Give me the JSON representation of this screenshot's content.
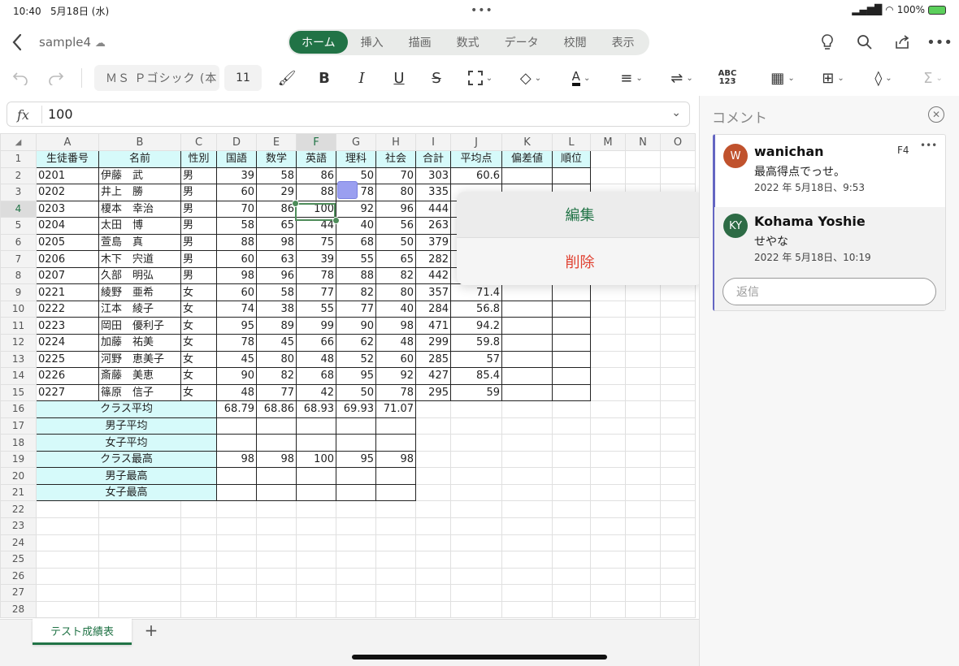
{
  "status": {
    "time": "10:40",
    "date": "5月18日 (水)",
    "battery": "100%"
  },
  "title": {
    "filename": "sample4"
  },
  "ribbon_tabs": [
    "ホーム",
    "挿入",
    "描画",
    "数式",
    "データ",
    "校閲",
    "表示"
  ],
  "toolbar": {
    "font": "ＭＳ Ｐゴシック (本",
    "size": "11"
  },
  "formula": {
    "fx": "fx",
    "value": "100"
  },
  "columns": [
    "A",
    "B",
    "C",
    "D",
    "E",
    "F",
    "G",
    "H",
    "I",
    "J",
    "K",
    "L",
    "M",
    "N",
    "O"
  ],
  "rows": [
    [
      "生徒番号",
      "名前",
      "性別",
      "国語",
      "数学",
      "英語",
      "理科",
      "社会",
      "合計",
      "平均点",
      "偏差値",
      "順位"
    ],
    [
      "0201",
      "伊藤　武",
      "男",
      "39",
      "58",
      "86",
      "50",
      "70",
      "303",
      "60.6",
      "",
      ""
    ],
    [
      "0202",
      "井上　勝",
      "男",
      "60",
      "29",
      "88",
      "78",
      "80",
      "335",
      "",
      "",
      ""
    ],
    [
      "0203",
      "榎本　幸治",
      "男",
      "70",
      "86",
      "100",
      "92",
      "96",
      "444",
      "",
      "",
      ""
    ],
    [
      "0204",
      "太田　博",
      "男",
      "58",
      "65",
      "44",
      "40",
      "56",
      "263",
      "",
      "",
      ""
    ],
    [
      "0205",
      "萱島　真",
      "男",
      "88",
      "98",
      "75",
      "68",
      "50",
      "379",
      "",
      "",
      ""
    ],
    [
      "0206",
      "木下　宍道",
      "男",
      "60",
      "63",
      "39",
      "55",
      "65",
      "282",
      "",
      "",
      ""
    ],
    [
      "0207",
      "久部　明弘",
      "男",
      "98",
      "96",
      "78",
      "88",
      "82",
      "442",
      "",
      "",
      ""
    ],
    [
      "0221",
      "綾野　亜希",
      "女",
      "60",
      "58",
      "77",
      "82",
      "80",
      "357",
      "71.4",
      "",
      ""
    ],
    [
      "0222",
      "江本　綾子",
      "女",
      "74",
      "38",
      "55",
      "77",
      "40",
      "284",
      "56.8",
      "",
      ""
    ],
    [
      "0223",
      "岡田　優利子",
      "女",
      "95",
      "89",
      "99",
      "90",
      "98",
      "471",
      "94.2",
      "",
      ""
    ],
    [
      "0224",
      "加藤　祐美",
      "女",
      "78",
      "45",
      "66",
      "62",
      "48",
      "299",
      "59.8",
      "",
      ""
    ],
    [
      "0225",
      "河野　恵美子",
      "女",
      "45",
      "80",
      "48",
      "52",
      "60",
      "285",
      "57",
      "",
      ""
    ],
    [
      "0226",
      "斎藤　美恵",
      "女",
      "90",
      "82",
      "68",
      "95",
      "92",
      "427",
      "85.4",
      "",
      ""
    ],
    [
      "0227",
      "篠原　信子",
      "女",
      "48",
      "77",
      "42",
      "50",
      "78",
      "295",
      "59",
      "",
      ""
    ]
  ],
  "summary": [
    {
      "label": "クラス平均",
      "vals": [
        "68.79",
        "68.86",
        "68.93",
        "69.93",
        "71.07"
      ]
    },
    {
      "label": "男子平均",
      "vals": [
        "",
        "",
        "",
        "",
        ""
      ]
    },
    {
      "label": "女子平均",
      "vals": [
        "",
        "",
        "",
        "",
        ""
      ]
    },
    {
      "label": "クラス最高",
      "vals": [
        "98",
        "98",
        "100",
        "95",
        "98"
      ]
    },
    {
      "label": "男子最高",
      "vals": [
        "",
        "",
        "",
        "",
        ""
      ]
    },
    {
      "label": "女子最高",
      "vals": [
        "",
        "",
        "",
        "",
        ""
      ]
    }
  ],
  "context_menu": {
    "edit": "編集",
    "delete": "削除"
  },
  "comments_panel": {
    "title": "コメント",
    "cell_ref": "F4",
    "more": "•••",
    "comments": [
      {
        "initials": "W",
        "author": "wanichan",
        "text": "最高得点でっせ。",
        "date": "2022 年 5月18日、9:53",
        "color": "#c0522d"
      },
      {
        "initials": "KY",
        "author": "Kohama Yoshie",
        "text": "せやな",
        "date": "2022 年 5月18日、10:19",
        "color": "#2d6b45"
      }
    ],
    "reply_placeholder": "返信"
  },
  "sheet": {
    "name": "テスト成績表",
    "add": "+"
  }
}
